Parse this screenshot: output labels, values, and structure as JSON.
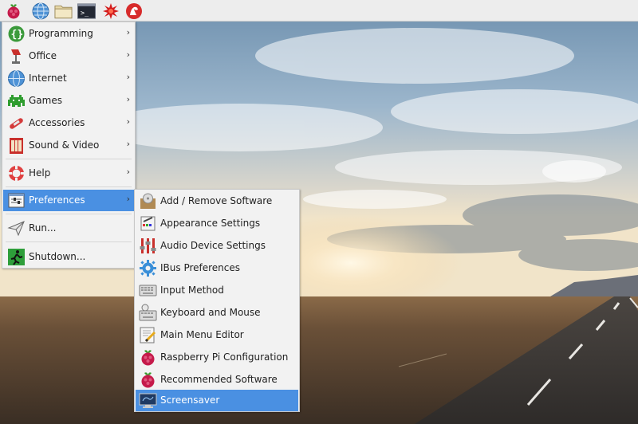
{
  "taskbar": {
    "launchers": [
      {
        "icon": "raspberry-menu-icon"
      },
      {
        "icon": "web-browser-icon"
      },
      {
        "icon": "file-manager-icon"
      },
      {
        "icon": "terminal-icon",
        "glyph": ">_"
      },
      {
        "icon": "mathematica-icon"
      },
      {
        "icon": "wolfram-icon"
      }
    ]
  },
  "main_menu": {
    "items": [
      {
        "label": "Programming",
        "icon": "programming-icon",
        "has_submenu": true
      },
      {
        "label": "Office",
        "icon": "office-icon",
        "has_submenu": true
      },
      {
        "label": "Internet",
        "icon": "internet-icon",
        "has_submenu": true
      },
      {
        "label": "Games",
        "icon": "games-icon",
        "has_submenu": true
      },
      {
        "label": "Accessories",
        "icon": "accessories-icon",
        "has_submenu": true
      },
      {
        "label": "Sound & Video",
        "icon": "sound-video-icon",
        "has_submenu": true
      },
      {
        "label": "Help",
        "icon": "help-icon",
        "has_submenu": true
      },
      {
        "label": "Preferences",
        "icon": "preferences-icon",
        "has_submenu": true,
        "active": true
      },
      {
        "label": "Run...",
        "icon": "run-icon",
        "has_submenu": false
      },
      {
        "label": "Shutdown...",
        "icon": "shutdown-icon",
        "has_submenu": false
      }
    ],
    "arrow": "›"
  },
  "preferences_submenu": {
    "items": [
      {
        "label": "Add / Remove Software",
        "icon": "add-remove-software-icon"
      },
      {
        "label": "Appearance Settings",
        "icon": "appearance-settings-icon"
      },
      {
        "label": "Audio Device Settings",
        "icon": "audio-device-settings-icon"
      },
      {
        "label": "IBus Preferences",
        "icon": "ibus-preferences-icon"
      },
      {
        "label": "Input Method",
        "icon": "input-method-icon"
      },
      {
        "label": "Keyboard and Mouse",
        "icon": "keyboard-mouse-icon"
      },
      {
        "label": "Main Menu Editor",
        "icon": "main-menu-editor-icon"
      },
      {
        "label": "Raspberry Pi Configuration",
        "icon": "raspberry-pi-configuration-icon"
      },
      {
        "label": "Recommended Software",
        "icon": "recommended-software-icon"
      },
      {
        "label": "Screensaver",
        "icon": "screensaver-icon",
        "active": true
      }
    ]
  },
  "colors": {
    "highlight": "#4a90e2",
    "menu_bg": "#f2f2f2",
    "taskbar_bg": "#ededed"
  }
}
